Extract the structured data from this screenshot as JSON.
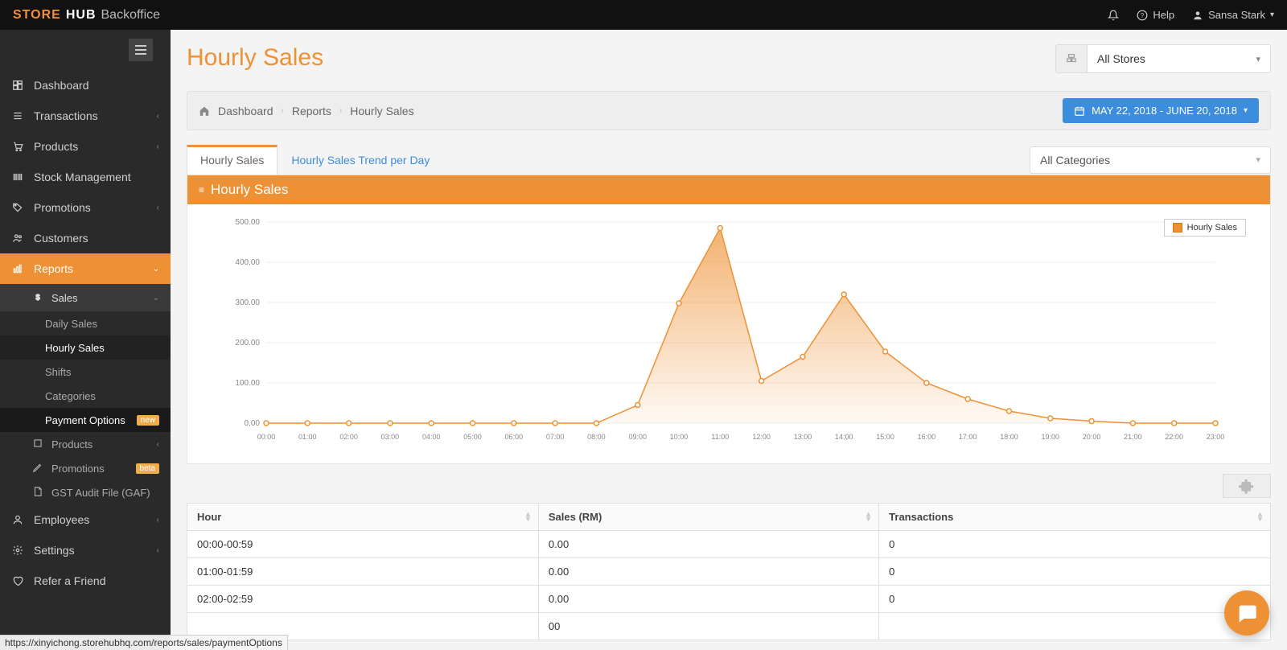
{
  "brand": {
    "strong": "STORE",
    "rest": "HUB",
    "sub": "Backoffice"
  },
  "topbar": {
    "help": "Help",
    "user": "Sansa Stark"
  },
  "sidebar": {
    "items": [
      {
        "label": "Dashboard",
        "icon": "dashboard",
        "expandable": false
      },
      {
        "label": "Transactions",
        "icon": "list",
        "expandable": true
      },
      {
        "label": "Products",
        "icon": "cart",
        "expandable": true
      },
      {
        "label": "Stock Management",
        "icon": "barcode",
        "expandable": false
      },
      {
        "label": "Promotions",
        "icon": "tag",
        "expandable": true
      },
      {
        "label": "Customers",
        "icon": "users",
        "expandable": false
      },
      {
        "label": "Reports",
        "icon": "chart",
        "expandable": true,
        "active": true
      },
      {
        "label": "Employees",
        "icon": "user",
        "expandable": true
      },
      {
        "label": "Settings",
        "icon": "gear",
        "expandable": true
      },
      {
        "label": "Refer a Friend",
        "icon": "heart",
        "expandable": false
      }
    ],
    "reports_sub": {
      "sales": {
        "label": "Sales",
        "items": [
          {
            "label": "Daily Sales"
          },
          {
            "label": "Hourly Sales",
            "active": true
          },
          {
            "label": "Shifts"
          },
          {
            "label": "Categories"
          },
          {
            "label": "Payment Options",
            "badge": "new",
            "highlighted": true
          }
        ]
      },
      "products": {
        "label": "Products"
      },
      "promotions": {
        "label": "Promotions",
        "badge": "beta"
      },
      "gst": {
        "label": "GST Audit File (GAF)"
      }
    }
  },
  "page": {
    "title": "Hourly Sales",
    "store_selector": "All Stores",
    "breadcrumb": [
      "Dashboard",
      "Reports",
      "Hourly Sales"
    ],
    "date_range": "MAY 22, 2018 - JUNE 20, 2018",
    "tabs": [
      "Hourly Sales",
      "Hourly Sales Trend per Day"
    ],
    "category_filter": "All Categories",
    "chart_title": "Hourly Sales",
    "legend": "Hourly Sales",
    "table": {
      "columns": [
        "Hour",
        "Sales (RM)",
        "Transactions"
      ],
      "rows": [
        [
          "00:00-00:59",
          "0.00",
          "0"
        ],
        [
          "01:00-01:59",
          "0.00",
          "0"
        ],
        [
          "02:00-02:59",
          "0.00",
          "0"
        ],
        [
          "",
          "00",
          ""
        ]
      ]
    }
  },
  "status_url": "https://xinyichong.storehubhq.com/reports/sales/paymentOptions",
  "chart_data": {
    "type": "area",
    "title": "Hourly Sales",
    "xlabel": "",
    "ylabel": "",
    "ylim": [
      0,
      500
    ],
    "y_ticks": [
      "0.00",
      "100.00",
      "200.00",
      "300.00",
      "400.00",
      "500.00"
    ],
    "categories": [
      "00:00",
      "01:00",
      "02:00",
      "03:00",
      "04:00",
      "05:00",
      "06:00",
      "07:00",
      "08:00",
      "09:00",
      "10:00",
      "11:00",
      "12:00",
      "13:00",
      "14:00",
      "15:00",
      "16:00",
      "17:00",
      "18:00",
      "19:00",
      "20:00",
      "21:00",
      "22:00",
      "23:00"
    ],
    "series": [
      {
        "name": "Hourly Sales",
        "values": [
          0,
          0,
          0,
          0,
          0,
          0,
          0,
          0,
          0,
          45,
          298,
          485,
          105,
          165,
          320,
          178,
          100,
          60,
          30,
          12,
          5,
          0,
          0,
          0
        ]
      }
    ],
    "legend_position": "top-right",
    "grid": true,
    "colors": {
      "series1": "#ee9135"
    }
  }
}
